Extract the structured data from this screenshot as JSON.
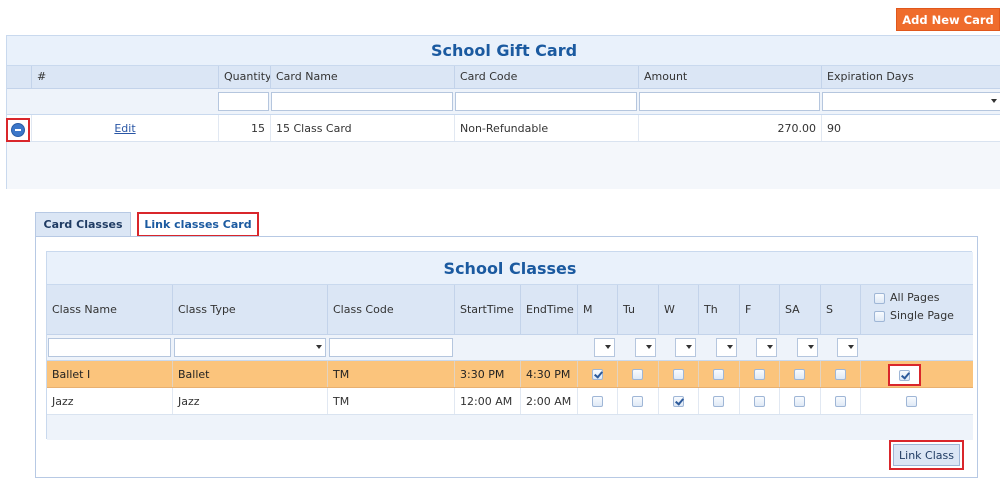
{
  "toolbar": {
    "add_new_card": "Add New Card"
  },
  "gift": {
    "title": "School Gift Card",
    "columns": [
      "#",
      "Quantity",
      "Card Name",
      "Card Code",
      "Amount",
      "Expiration Days"
    ],
    "row": {
      "edit": "Edit",
      "quantity": "15",
      "card_name": "15 Class Card",
      "card_code": "Non-Refundable",
      "amount": "270.00",
      "expiration_days": "90"
    }
  },
  "tabs": {
    "card_classes": "Card Classes",
    "link_classes_card": "Link classes Card"
  },
  "classes": {
    "title": "School Classes",
    "columns": [
      "Class Name",
      "Class Type",
      "Class Code",
      "StartTime",
      "EndTime",
      "M",
      "Tu",
      "W",
      "Th",
      "F",
      "SA",
      "S"
    ],
    "all_pages": "All Pages",
    "single_page": "Single Page",
    "rows": [
      {
        "name": "Ballet I",
        "type": "Ballet",
        "code": "TM",
        "start": "3:30 PM",
        "end": "4:30 PM",
        "days": [
          true,
          false,
          false,
          false,
          false,
          false,
          false
        ],
        "selected": true
      },
      {
        "name": "Jazz",
        "type": "Jazz",
        "code": "TM",
        "start": "12:00 AM",
        "end": "2:00 AM",
        "days": [
          false,
          false,
          true,
          false,
          false,
          false,
          false
        ],
        "selected": false
      }
    ]
  },
  "link_class": "Link Class",
  "colors": {
    "accent": "#ef6c2c",
    "highlight": "#d9262b",
    "selected_row": "#fbc47c",
    "title": "#1b5aa0"
  }
}
